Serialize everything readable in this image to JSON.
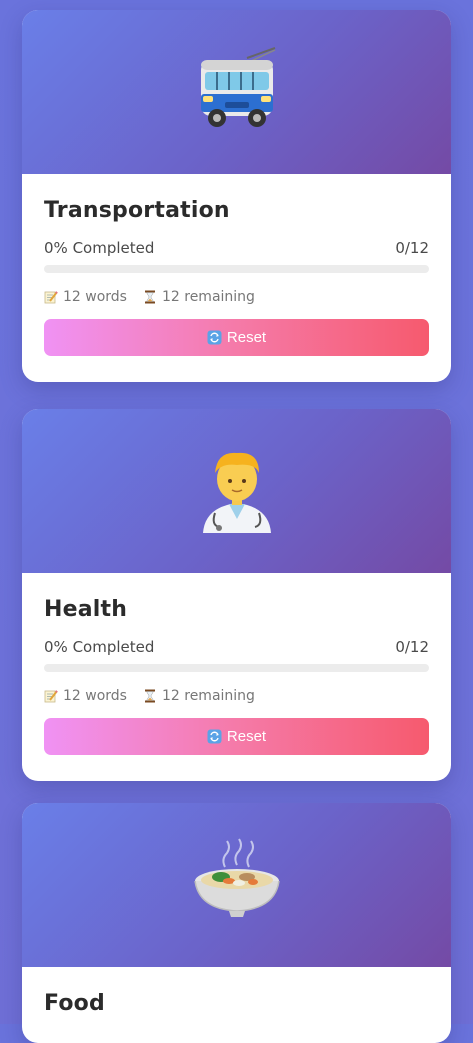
{
  "cards": [
    {
      "title": "Transportation",
      "emoji": "trolleybus-icon",
      "progress_text": "0% Completed",
      "progress_count": "0/12",
      "progress_fraction": 0,
      "words": "12 words",
      "remaining": "12 remaining",
      "reset_label": "Reset"
    },
    {
      "title": "Health",
      "emoji": "health-worker-icon",
      "progress_text": "0% Completed",
      "progress_count": "0/12",
      "progress_fraction": 0,
      "words": "12 words",
      "remaining": "12 remaining",
      "reset_label": "Reset"
    },
    {
      "title": "Food",
      "emoji": "pot-of-food-icon",
      "progress_text": "",
      "progress_count": "",
      "progress_fraction": 0,
      "words": "",
      "remaining": "",
      "reset_label": ""
    }
  ],
  "colors": {
    "page_bg": "#6c72da",
    "hero_start": "#6a7fe8",
    "hero_end": "#744aa5",
    "button_start": "#f093fb",
    "button_end": "#f5576c"
  }
}
